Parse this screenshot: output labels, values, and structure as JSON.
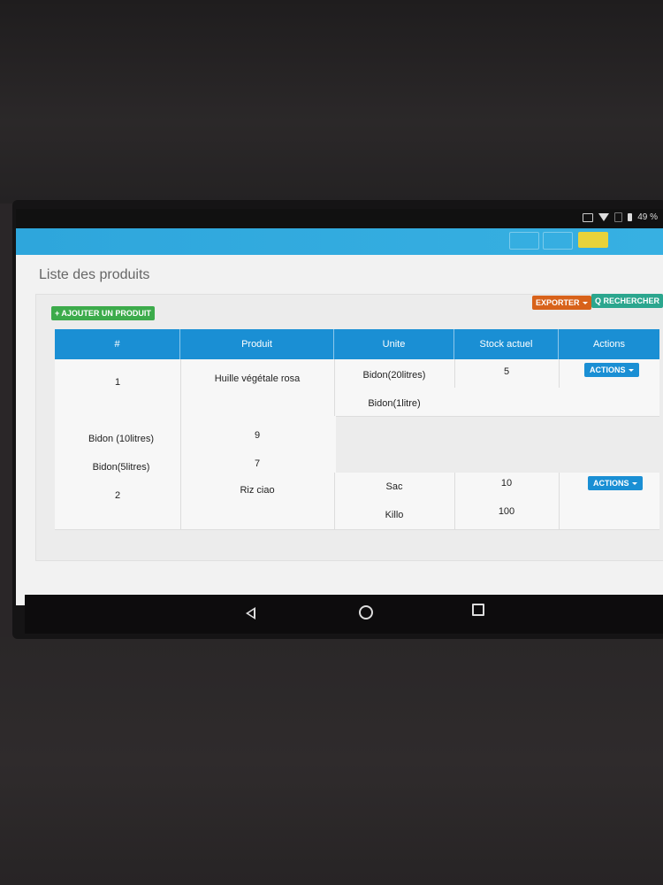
{
  "status_bar": {
    "battery": "49 %",
    "icons": [
      "vibrate-icon",
      "wifi-icon",
      "no-sim-icon",
      "battery-icon"
    ]
  },
  "page": {
    "title": "Liste des produits"
  },
  "toolbar": {
    "add_label": "+ AJOUTER UN PRODUIT",
    "export_label": "EXPORTER",
    "search_label": "Q RECHERCHER"
  },
  "table": {
    "headers": [
      "#",
      "Produit",
      "Unite",
      "Stock actuel",
      "Actions"
    ],
    "rows": [
      {
        "num": "1",
        "product": "Huille végétale rosa",
        "unit": "Bidon(20litres)",
        "stock": "5",
        "action": "ACTIONS"
      },
      {
        "unit": "Bidon(1litre)"
      },
      {
        "unit": "Bidon (10litres)",
        "stock": "9"
      },
      {
        "unit": "Bidon(5litres)",
        "stock": "7"
      },
      {
        "num": "2",
        "product": "Riz ciao",
        "unit": "Sac",
        "stock": "10",
        "action": "ACTIONS"
      },
      {
        "unit": "Killo",
        "stock": "100"
      }
    ]
  },
  "colors": {
    "header": "#1a8fd4",
    "add": "#3cab4b",
    "export": "#d8621a",
    "search": "#2ba68e"
  }
}
